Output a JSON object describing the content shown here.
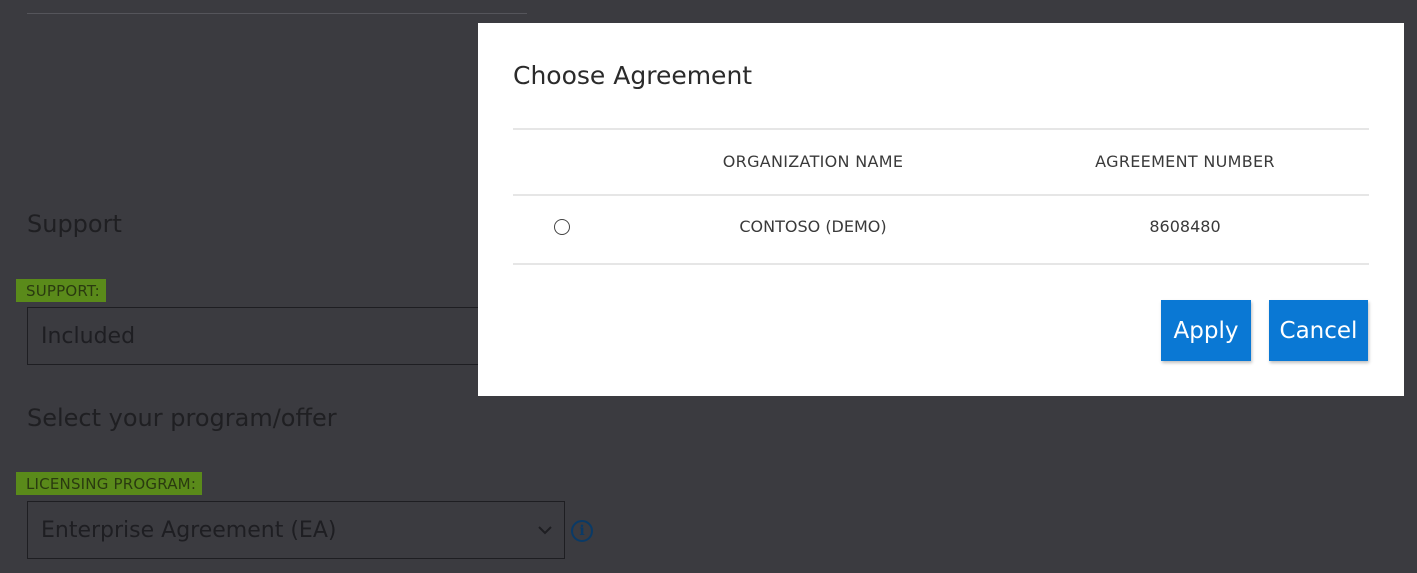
{
  "background": {
    "support": {
      "heading": "Support",
      "label": "SUPPORT:",
      "value": "Included"
    },
    "program": {
      "heading": "Select your program/offer",
      "label": "LICENSING PROGRAM:",
      "value": "Enterprise Agreement (EA)",
      "chevron": "⌄",
      "info": "i"
    }
  },
  "modal": {
    "title": "Choose Agreement",
    "columns": [
      "ORGANIZATION NAME",
      "AGREEMENT NUMBER"
    ],
    "rows": [
      {
        "organization": "CONTOSO (DEMO)",
        "agreement": "8608480",
        "selected": false
      }
    ],
    "apply_label": "Apply",
    "cancel_label": "Cancel"
  },
  "colors": {
    "overlay": "#3b3b40",
    "highlight": "#5a8a1a",
    "primary_button": "#0a78d4"
  },
  "icons": {
    "chevron": "chevron-down-icon",
    "info": "info-icon"
  }
}
